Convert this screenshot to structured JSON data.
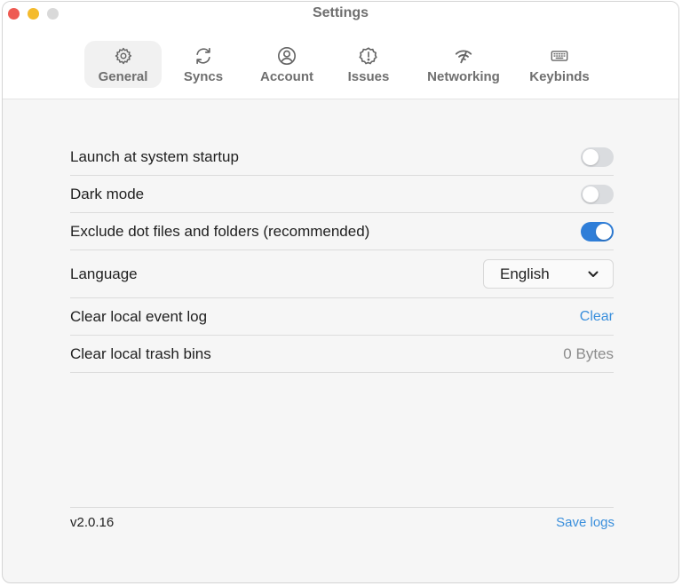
{
  "window": {
    "title": "Settings"
  },
  "tabs": [
    {
      "label": "General",
      "icon": "gear-icon",
      "active": true
    },
    {
      "label": "Syncs",
      "icon": "sync-icon",
      "active": false
    },
    {
      "label": "Account",
      "icon": "user-circle-icon",
      "active": false
    },
    {
      "label": "Issues",
      "icon": "alert-icon",
      "active": false
    },
    {
      "label": "Networking",
      "icon": "wifi-icon",
      "active": false
    },
    {
      "label": "Keybinds",
      "icon": "keyboard-icon",
      "active": false
    }
  ],
  "settings": {
    "launch_startup": {
      "label": "Launch at system startup",
      "enabled": false
    },
    "dark_mode": {
      "label": "Dark mode",
      "enabled": false
    },
    "exclude_dot": {
      "label": "Exclude dot files and folders (recommended)",
      "enabled": true
    },
    "language": {
      "label": "Language",
      "value": "English"
    },
    "clear_event_log": {
      "label": "Clear local event log",
      "action": "Clear"
    },
    "clear_trash": {
      "label": "Clear local trash bins",
      "value": "0 Bytes"
    }
  },
  "footer": {
    "version": "v2.0.16",
    "save_logs": "Save logs"
  },
  "colors": {
    "accent": "#2f7ed8",
    "link": "#3a8fdc",
    "close": "#ee5a52",
    "minimize": "#f4bb2d"
  }
}
